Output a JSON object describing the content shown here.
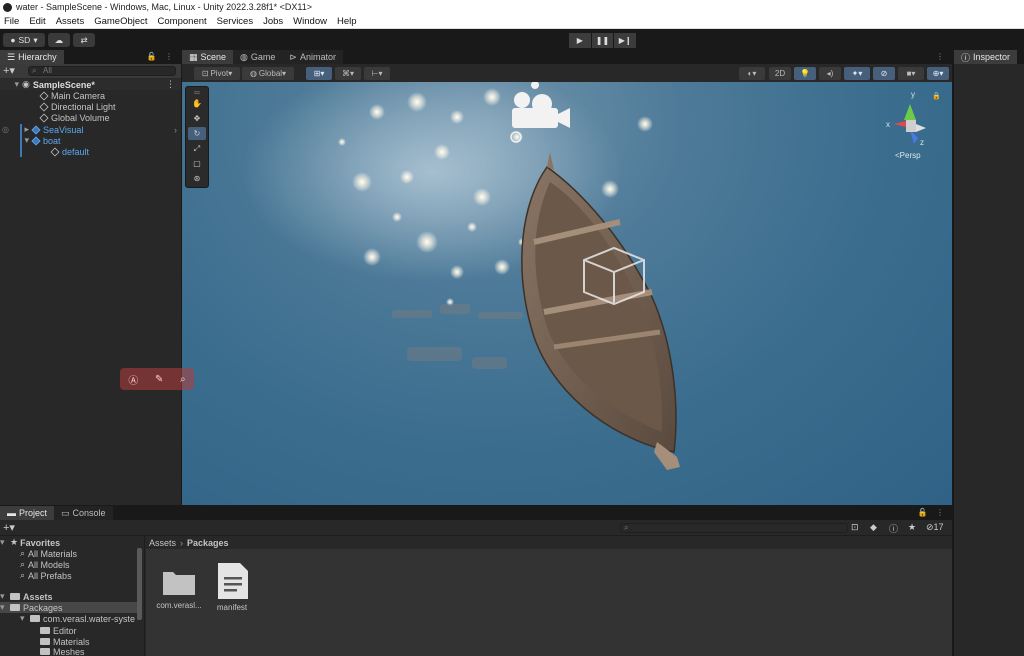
{
  "window": {
    "title": "water - SampleScene - Windows, Mac, Linux - Unity 2022.3.28f1* <DX11>"
  },
  "menu": [
    "File",
    "Edit",
    "Assets",
    "GameObject",
    "Component",
    "Services",
    "Jobs",
    "Window",
    "Help"
  ],
  "toolbar": {
    "account": "SD",
    "play_icons": [
      "▶",
      "❚❚",
      "▶❙"
    ]
  },
  "hierarchy": {
    "tab": "Hierarchy",
    "search_placeholder": "All",
    "scene": "SampleScene*",
    "items": [
      {
        "label": "Main Camera",
        "highlight": false
      },
      {
        "label": "Directional Light",
        "highlight": false
      },
      {
        "label": "Global Volume",
        "highlight": false
      },
      {
        "label": "SeaVisual",
        "highlight": true
      },
      {
        "label": "boat",
        "highlight": true
      },
      {
        "label": "default",
        "highlight": true
      }
    ]
  },
  "scene": {
    "tabs": [
      "Scene",
      "Game",
      "Animator"
    ],
    "pivot": "Pivot",
    "global": "Global",
    "mode_2d": "2D",
    "persp": "<Persp",
    "axis_y": "y",
    "axis_x": "x",
    "axis_z": "z"
  },
  "project": {
    "tabs": [
      "Project",
      "Console"
    ],
    "hidden_count": "17",
    "favorites_header": "Favorites",
    "favorites": [
      "All Materials",
      "All Models",
      "All Prefabs"
    ],
    "assets_header": "Assets",
    "packages": "Packages",
    "package_item": "com.verasl.water-syste",
    "subfolders": [
      "Editor",
      "Materials",
      "Meshes"
    ],
    "breadcrumb_root": "Assets",
    "breadcrumb_current": "Packages",
    "grid": [
      {
        "label": "com.verasl...",
        "kind": "folder"
      },
      {
        "label": "manifest",
        "kind": "file"
      }
    ]
  },
  "inspector": {
    "tab": "Inspector"
  },
  "colors": {
    "editor_bg": "#191919",
    "panel_bg": "#282828",
    "water": "#3b6d8e",
    "highlight_blue": "#5ea8ee",
    "tool_active": "#46607c"
  }
}
